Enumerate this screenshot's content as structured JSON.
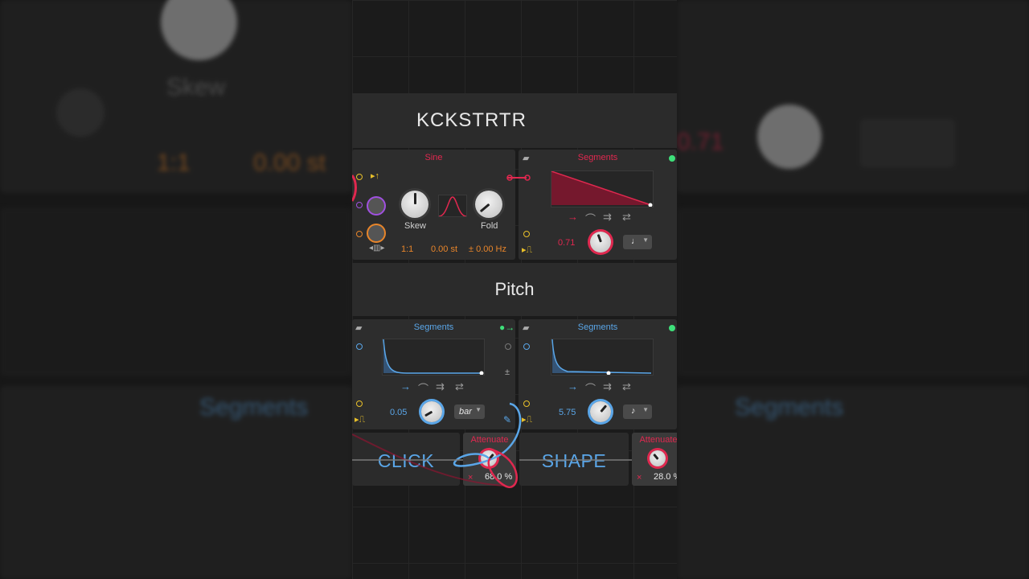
{
  "background_left": {
    "skew_label": "Skew",
    "ratio": "1:1",
    "semitones": "0.00 st"
  },
  "background_right": {
    "value": "0.71",
    "segments_label": "Segments"
  },
  "background_left_bottom": {
    "segments_label": "Segments"
  },
  "header_top": {
    "title": "KCKSTRTR"
  },
  "header_pitch": {
    "title": "Pitch"
  },
  "sine_device": {
    "title": "Sine",
    "skew_label": "Skew",
    "fold_label": "Fold",
    "ratio": "1:1",
    "semitones": "0.00 st",
    "hz": "± 0.00 Hz"
  },
  "segments_top": {
    "title": "Segments",
    "value": "0.71",
    "rate": "♩"
  },
  "segments_pitch_left": {
    "title": "Segments",
    "value": "0.05",
    "rate": "bar"
  },
  "segments_pitch_right": {
    "title": "Segments",
    "value": "5.75",
    "rate": "♪"
  },
  "macros": {
    "click": "CLICK",
    "shape": "SHAPE"
  },
  "attenuate_left": {
    "title": "Attenuate",
    "value": "68.0 %",
    "x": "×"
  },
  "attenuate_right": {
    "title": "Attenuate",
    "value": "28.0 %",
    "x": "×"
  },
  "colors": {
    "accent_red": "#e0284f",
    "accent_blue": "#5aa6e8",
    "accent_orange": "#e8852a",
    "accent_green": "#3ee07a",
    "accent_yellow": "#e8c02a"
  }
}
